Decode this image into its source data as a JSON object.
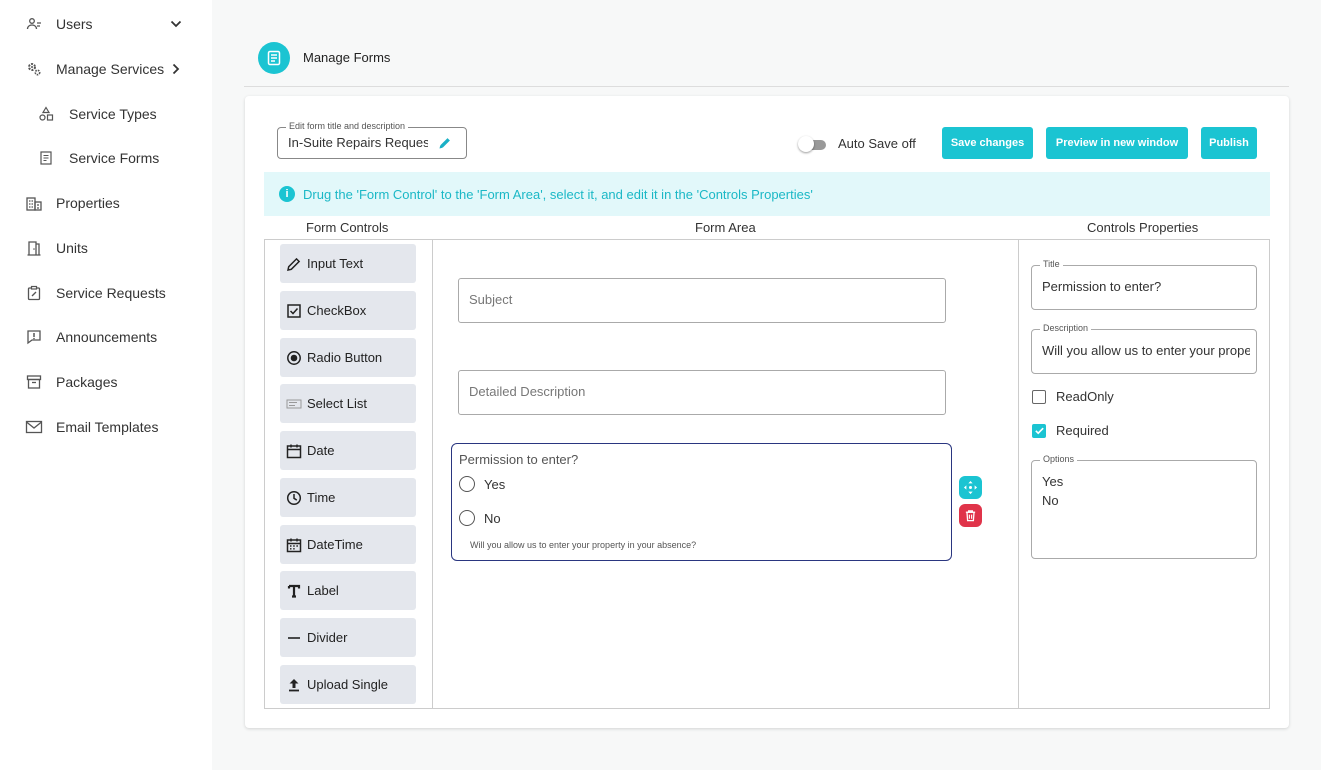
{
  "sidebar": {
    "items": [
      {
        "label": "Users",
        "icon": "users-icon"
      },
      {
        "label": "Manage Services",
        "icon": "gears-icon"
      },
      {
        "label": "Service Types",
        "icon": "shapes-icon"
      },
      {
        "label": "Service Forms",
        "icon": "document-icon"
      },
      {
        "label": "Properties",
        "icon": "building-icon"
      },
      {
        "label": "Units",
        "icon": "door-icon"
      },
      {
        "label": "Service Requests",
        "icon": "clipboard-icon"
      },
      {
        "label": "Announcements",
        "icon": "alert-message-icon"
      },
      {
        "label": "Packages",
        "icon": "archive-icon"
      },
      {
        "label": "Email Templates",
        "icon": "envelope-icon"
      }
    ]
  },
  "header": {
    "title": "Manage Forms"
  },
  "toolbar": {
    "title_field_label": "Edit form title and description",
    "title_field_value": "In-Suite Repairs Request",
    "autosave_label": "Auto Save off",
    "save_label": "Save changes",
    "preview_label": "Preview in new window",
    "publish_label": "Publish"
  },
  "info": {
    "text": "Drug the 'Form Control' to the 'Form Area', select it, and edit it in the 'Controls Properties'"
  },
  "columns": {
    "controls": "Form Controls",
    "area": "Form Area",
    "properties": "Controls Properties"
  },
  "controls": [
    {
      "label": "Input Text",
      "icon": "pencil-icon"
    },
    {
      "label": "CheckBox",
      "icon": "checkbox-icon"
    },
    {
      "label": "Radio Button",
      "icon": "radio-icon"
    },
    {
      "label": "Select List",
      "icon": "select-list-icon"
    },
    {
      "label": "Date",
      "icon": "calendar-icon"
    },
    {
      "label": "Time",
      "icon": "clock-icon"
    },
    {
      "label": "DateTime",
      "icon": "calendar-clock-icon"
    },
    {
      "label": "Label",
      "icon": "text-t-icon"
    },
    {
      "label": "Divider",
      "icon": "divider-icon"
    },
    {
      "label": "Upload Single",
      "icon": "upload-icon"
    }
  ],
  "form_area": {
    "subject_placeholder": "Subject",
    "description_placeholder": "Detailed Description",
    "radio": {
      "question": "Permission to enter?",
      "options": [
        "Yes",
        "No"
      ],
      "description": "Will you allow us to enter your property in your absence?"
    }
  },
  "properties": {
    "title_label": "Title",
    "title_value": "Permission to enter?",
    "description_label": "Description",
    "description_value": "Will you allow us to enter your property in your absence?",
    "readonly_label": "ReadOnly",
    "required_label": "Required",
    "options_label": "Options",
    "options_values": [
      "Yes",
      "No"
    ]
  },
  "colors": {
    "accent": "#1bc4d2",
    "danger": "#e0344a",
    "selected_border": "#2a3680"
  }
}
